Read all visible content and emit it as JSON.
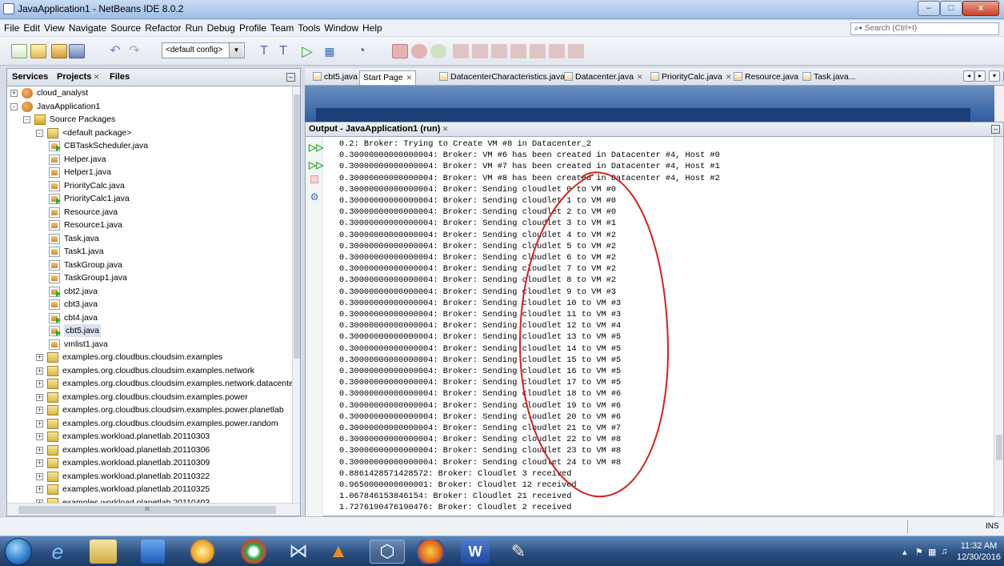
{
  "window": {
    "title": "JavaApplication1 - NetBeans IDE 8.0.2",
    "min": "–",
    "max": "□",
    "close": "x"
  },
  "menu": [
    "File",
    "Edit",
    "View",
    "Navigate",
    "Source",
    "Refactor",
    "Run",
    "Debug",
    "Profile",
    "Team",
    "Tools",
    "Window",
    "Help"
  ],
  "search": {
    "placeholder": "Search (Ctrl+I)"
  },
  "toolbar": {
    "config": "<default config>"
  },
  "left_panel": {
    "tabs": [
      "Services",
      "Projects",
      "Files"
    ],
    "tree": [
      {
        "label": "cloud_analyst",
        "level": 0,
        "exp": "+",
        "icon": "proj"
      },
      {
        "label": "JavaApplication1",
        "level": 0,
        "exp": "-",
        "icon": "proj"
      },
      {
        "label": "Source Packages",
        "level": 1,
        "exp": "-",
        "icon": "src"
      },
      {
        "label": "<default package>",
        "level": 2,
        "exp": "-",
        "icon": "pkg"
      },
      {
        "label": "CBTaskScheduler.java",
        "level": 3,
        "icon": "run"
      },
      {
        "label": "Helper.java",
        "level": 3,
        "icon": "java"
      },
      {
        "label": "Helper1.java",
        "level": 3,
        "icon": "java"
      },
      {
        "label": "PriorityCalc.java",
        "level": 3,
        "icon": "java"
      },
      {
        "label": "PriorityCalc1.java",
        "level": 3,
        "icon": "run"
      },
      {
        "label": "Resource.java",
        "level": 3,
        "icon": "java"
      },
      {
        "label": "Resource1.java",
        "level": 3,
        "icon": "java"
      },
      {
        "label": "Task.java",
        "level": 3,
        "icon": "java"
      },
      {
        "label": "Task1.java",
        "level": 3,
        "icon": "java"
      },
      {
        "label": "TaskGroup.java",
        "level": 3,
        "icon": "java"
      },
      {
        "label": "TaskGroup1.java",
        "level": 3,
        "icon": "java"
      },
      {
        "label": "cbt2.java",
        "level": 3,
        "icon": "run"
      },
      {
        "label": "cbt3.java",
        "level": 3,
        "icon": "java"
      },
      {
        "label": "cbt4.java",
        "level": 3,
        "icon": "run"
      },
      {
        "label": "cbt5.java",
        "level": 3,
        "icon": "run",
        "selected": true
      },
      {
        "label": "vmlist1.java",
        "level": 3,
        "icon": "java"
      },
      {
        "label": "examples.org.cloudbus.cloudsim.examples",
        "level": 2,
        "exp": "+",
        "icon": "pkg"
      },
      {
        "label": "examples.org.cloudbus.cloudsim.examples.network",
        "level": 2,
        "exp": "+",
        "icon": "pkg"
      },
      {
        "label": "examples.org.cloudbus.cloudsim.examples.network.datacente",
        "level": 2,
        "exp": "+",
        "icon": "pkg"
      },
      {
        "label": "examples.org.cloudbus.cloudsim.examples.power",
        "level": 2,
        "exp": "+",
        "icon": "pkg"
      },
      {
        "label": "examples.org.cloudbus.cloudsim.examples.power.planetlab",
        "level": 2,
        "exp": "+",
        "icon": "pkg"
      },
      {
        "label": "examples.org.cloudbus.cloudsim.examples.power.random",
        "level": 2,
        "exp": "+",
        "icon": "pkg"
      },
      {
        "label": "examples.workload.planetlab.20110303",
        "level": 2,
        "exp": "+",
        "icon": "pkg"
      },
      {
        "label": "examples.workload.planetlab.20110306",
        "level": 2,
        "exp": "+",
        "icon": "pkg"
      },
      {
        "label": "examples.workload.planetlab.20110309",
        "level": 2,
        "exp": "+",
        "icon": "pkg"
      },
      {
        "label": "examples.workload.planetlab.20110322",
        "level": 2,
        "exp": "+",
        "icon": "pkg"
      },
      {
        "label": "examples.workload.planetlab.20110325",
        "level": 2,
        "exp": "+",
        "icon": "pkg"
      },
      {
        "label": "examples.workload.planetlab.20110403",
        "level": 2,
        "exp": "+",
        "icon": "pkg"
      }
    ],
    "hscroll_label": "III"
  },
  "editor_tabs": [
    "cbt5.java",
    "Start Page",
    "DatacenterCharacteristics.java",
    "Datacenter.java",
    "PriorityCalc.java",
    "Resource.java",
    "Task.java..."
  ],
  "output": {
    "title": "Output - JavaApplication1 (run)",
    "lines": [
      "0.2: Broker: Trying to Create VM #8 in Datacenter_2",
      "0.30000000000000004: Broker: VM #6 has been created in Datacenter #4, Host #0",
      "0.30000000000000004: Broker: VM #7 has been created in Datacenter #4, Host #1",
      "0.30000000000000004: Broker: VM #8 has been created in Datacenter #4, Host #2",
      "0.30000000000000004: Broker: Sending cloudlet 0 to VM #0",
      "0.30000000000000004: Broker: Sending cloudlet 1 to VM #0",
      "0.30000000000000004: Broker: Sending cloudlet 2 to VM #0",
      "0.30000000000000004: Broker: Sending cloudlet 3 to VM #1",
      "0.30000000000000004: Broker: Sending cloudlet 4 to VM #2",
      "0.30000000000000004: Broker: Sending cloudlet 5 to VM #2",
      "0.30000000000000004: Broker: Sending cloudlet 6 to VM #2",
      "0.30000000000000004: Broker: Sending cloudlet 7 to VM #2",
      "0.30000000000000004: Broker: Sending cloudlet 8 to VM #2",
      "0.30000000000000004: Broker: Sending cloudlet 9 to VM #3",
      "0.30000000000000004: Broker: Sending cloudlet 10 to VM #3",
      "0.30000000000000004: Broker: Sending cloudlet 11 to VM #3",
      "0.30000000000000004: Broker: Sending cloudlet 12 to VM #4",
      "0.30000000000000004: Broker: Sending cloudlet 13 to VM #5",
      "0.30000000000000004: Broker: Sending cloudlet 14 to VM #5",
      "0.30000000000000004: Broker: Sending cloudlet 15 to VM #5",
      "0.30000000000000004: Broker: Sending cloudlet 16 to VM #5",
      "0.30000000000000004: Broker: Sending cloudlet 17 to VM #5",
      "0.30000000000000004: Broker: Sending cloudlet 18 to VM #6",
      "0.30000000000000004: Broker: Sending cloudlet 19 to VM #6",
      "0.30000000000000004: Broker: Sending cloudlet 20 to VM #6",
      "0.30000000000000004: Broker: Sending cloudlet 21 to VM #7",
      "0.30000000000000004: Broker: Sending cloudlet 22 to VM #8",
      "0.30000000000000004: Broker: Sending cloudlet 23 to VM #8",
      "0.30000000000000004: Broker: Sending cloudlet 24 to VM #8",
      "0.8861428571428572: Broker: Cloudlet 3 received",
      "0.9650000000000001: Broker: Cloudlet 12 received",
      "1.067846153846154: Broker: Cloudlet 21 received",
      "1.7276190476190476: Broker: Cloudlet 2 received"
    ]
  },
  "status": {
    "mode": "INS"
  },
  "taskbar": {
    "time": "11:32 AM",
    "date": "12/30/2016"
  },
  "colors": {
    "annotation": "#d42020",
    "taskbar": "#2a4f80"
  }
}
